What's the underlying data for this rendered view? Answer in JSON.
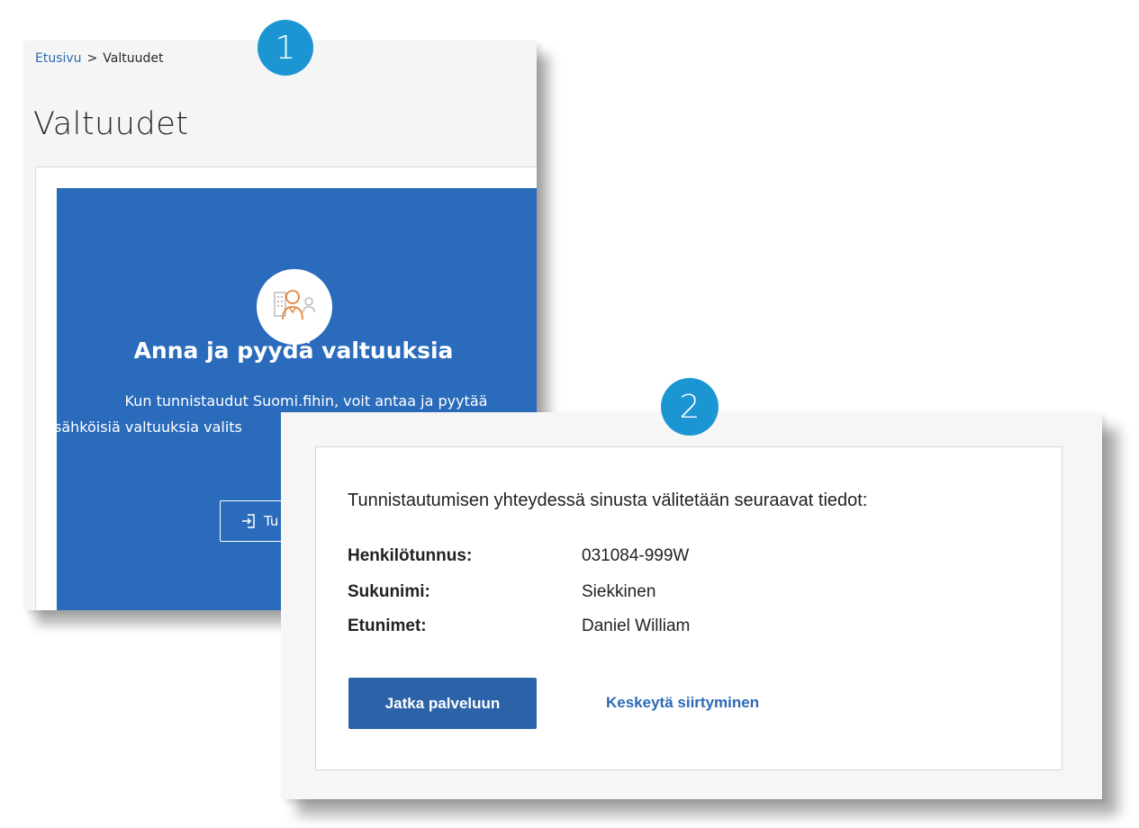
{
  "panel1": {
    "badge": "1",
    "breadcrumb": {
      "home": "Etusivu",
      "separator": ">",
      "current": "Valtuudet"
    },
    "title": "Valtuudet",
    "card": {
      "icon": "person-building-icon",
      "heading": "Anna ja pyydä valtuuksia",
      "text_line1": "Kun tunnistaudut Suomi.fihin, voit antaa ja pyytää",
      "text_line2": "sähköisiä valtuuksia valits",
      "login_button": {
        "icon": "login-icon",
        "label": "Tu"
      }
    },
    "colors": {
      "card_blue": "#2b6bbb",
      "link_blue": "#2b6ab8"
    }
  },
  "panel2": {
    "badge": "2",
    "intro": "Tunnistautumisen yhteydessä sinusta välitetään seuraavat tiedot:",
    "fields": [
      {
        "label": "Henkilötunnus:",
        "value": "031084-999W"
      },
      {
        "label": "Sukunimi:",
        "value": "Siekkinen"
      },
      {
        "label": "Etunimet:",
        "value": "Daniel William"
      }
    ],
    "continue_button": "Jatka palveluun",
    "cancel_link": "Keskeytä siirtyminen",
    "colors": {
      "button_blue": "#2b62a8",
      "badge_blue": "#1b96d3"
    }
  }
}
